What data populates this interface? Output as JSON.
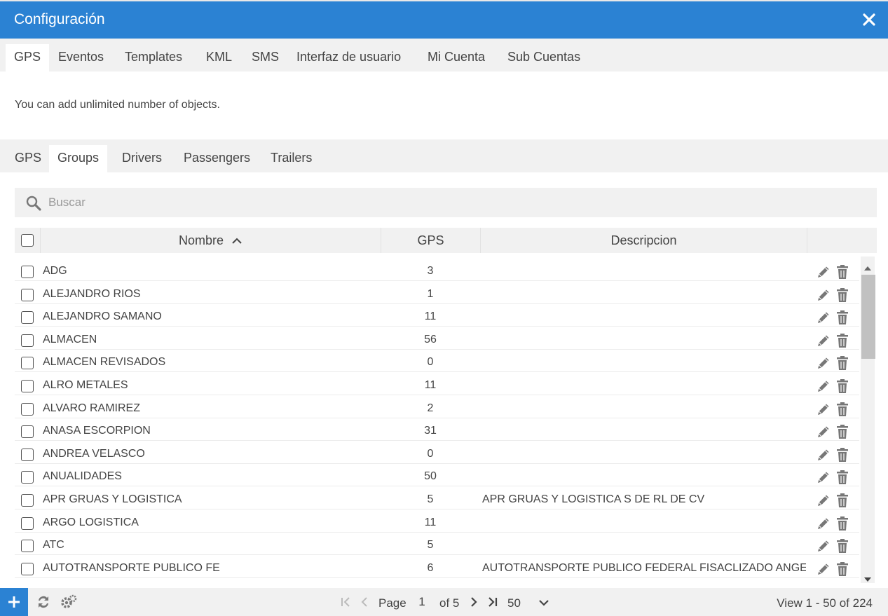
{
  "window": {
    "title": "Configuración"
  },
  "main_tabs": [
    {
      "label": "GPS"
    },
    {
      "label": "Eventos"
    },
    {
      "label": "Templates"
    },
    {
      "label": "KML"
    },
    {
      "label": "SMS"
    },
    {
      "label": "Interfaz de usuario"
    },
    {
      "label": "Mi Cuenta"
    },
    {
      "label": "Sub Cuentas"
    }
  ],
  "info_text": "You can add unlimited number of objects.",
  "sub_tabs": [
    {
      "label": "GPS"
    },
    {
      "label": "Groups"
    },
    {
      "label": "Drivers"
    },
    {
      "label": "Passengers"
    },
    {
      "label": "Trailers"
    }
  ],
  "search": {
    "placeholder": "Buscar"
  },
  "table": {
    "columns": {
      "name": "Nombre",
      "gps": "GPS",
      "desc": "Descripcion"
    },
    "rows": [
      {
        "name": "ADG",
        "gps": "3",
        "desc": ""
      },
      {
        "name": "ALEJANDRO RIOS",
        "gps": "1",
        "desc": ""
      },
      {
        "name": "ALEJANDRO SAMANO",
        "gps": "11",
        "desc": ""
      },
      {
        "name": "ALMACEN",
        "gps": "56",
        "desc": ""
      },
      {
        "name": "ALMACEN REVISADOS",
        "gps": "0",
        "desc": ""
      },
      {
        "name": "ALRO METALES",
        "gps": "11",
        "desc": ""
      },
      {
        "name": "ALVARO RAMIREZ",
        "gps": "2",
        "desc": ""
      },
      {
        "name": "ANASA ESCORPION",
        "gps": "31",
        "desc": ""
      },
      {
        "name": "ANDREA VELASCO",
        "gps": "0",
        "desc": ""
      },
      {
        "name": "ANUALIDADES",
        "gps": "50",
        "desc": ""
      },
      {
        "name": "APR GRUAS Y LOGISTICA",
        "gps": "5",
        "desc": "APR GRUAS Y LOGISTICA S DE RL DE CV"
      },
      {
        "name": "ARGO LOGISTICA",
        "gps": "11",
        "desc": ""
      },
      {
        "name": "ATC",
        "gps": "5",
        "desc": ""
      },
      {
        "name": "AUTOTRANSPORTE PUBLICO FE",
        "gps": "6",
        "desc": "AUTOTRANSPORTE PUBLICO FEDERAL FISACLIZADO ANGEL A"
      }
    ]
  },
  "pagination": {
    "page_label": "Page",
    "page_value": "1",
    "of_label": "of 5",
    "per_page": "50",
    "view_text": "View 1 - 50 of 224"
  },
  "colors": {
    "accent": "#2b82d3",
    "panel": "#f1f1f1",
    "icon": "#777777"
  }
}
